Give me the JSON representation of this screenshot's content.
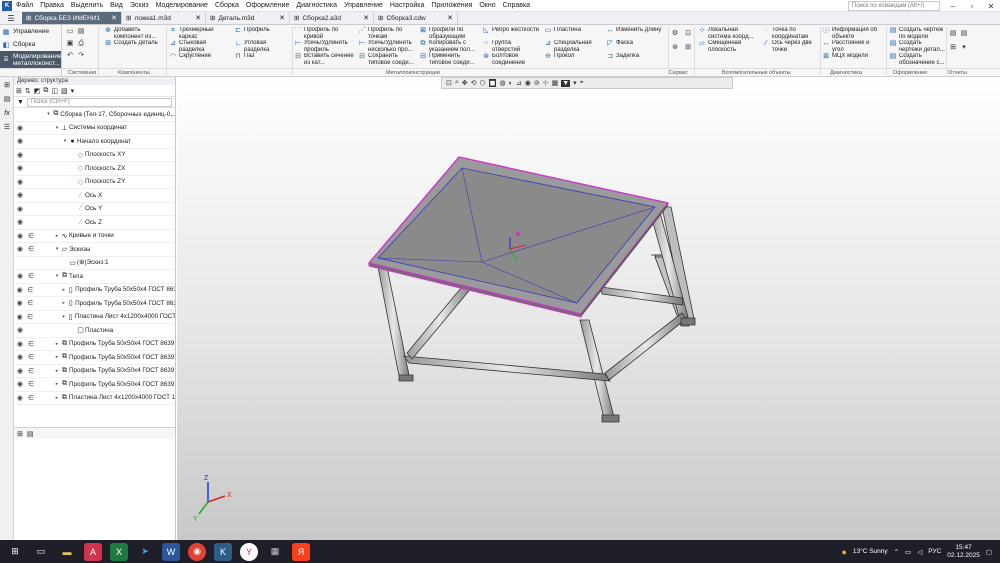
{
  "menu": [
    "Файл",
    "Правка",
    "Выделить",
    "Вид",
    "Эскиз",
    "Моделирование",
    "Сборка",
    "Оформление",
    "Диагностика",
    "Управление",
    "Настройка",
    "Приложения",
    "Окно",
    "Справка"
  ],
  "command_search_placeholder": "Поиск по командам (Alt+/)",
  "tabs": [
    {
      "label": "Сборка БЕЗ ИМЕНИ1",
      "active": true
    },
    {
      "label": "ложка1.m3d",
      "active": false
    },
    {
      "label": "Деталь.m3d",
      "active": false
    },
    {
      "label": "Сборка2.a3d",
      "active": false
    },
    {
      "label": "Сборка3.cdw",
      "active": false
    }
  ],
  "ribbon_left_tabs": [
    "Управление",
    "Сборка",
    "Моделирование металлоконст..."
  ],
  "ribbon": {
    "col1": [
      "Добавить компонент из...",
      "Создать деталь"
    ],
    "col2": [
      "Трехмерный каркас",
      "Стыковая разделка",
      "Скругление"
    ],
    "col3": [
      "Профиль",
      "Угловая разделка",
      "Паз"
    ],
    "col4": [
      "Профиль по кривой",
      "Усечь/Удлинить профиль",
      "Вставить сечение из кат..."
    ],
    "col5": [
      "Профиль по точкам",
      "Усечь/Удлинить несколько про...",
      "Сохранить типовое соеди..."
    ],
    "col6": [
      "Профили по образующим",
      "Копировать с указанием пол...",
      "Применить типовое соеди..."
    ],
    "col7": [
      "Ребро жесткости",
      "Группа отверстий",
      "Болтовое соединение"
    ],
    "col8": [
      "Пластина",
      "Специальная разделка",
      "Прокол"
    ],
    "col9": [
      "Изменить длину",
      "Фаска",
      "Заделка"
    ],
    "col10": [
      "Локальная система коорд...",
      "Смещенная плоскость"
    ],
    "col11": [
      "Точка по координатам",
      "Ось через две точки"
    ],
    "col12": [
      "Информация об объекте",
      "Расстояние и угол",
      "МЦХ модели"
    ],
    "col13": [
      "Создать чертеж по модели",
      "Создать чертежи детал...",
      "Создать обозначение с..."
    ]
  },
  "ribbon_groups": [
    "Системная",
    "Компоненты",
    "Металлоконструкции",
    "Сервис",
    "Вспомогательные объекты",
    "Диагностика",
    "Оформление",
    "Отчеты"
  ],
  "panel": {
    "title": "Дерево: структура",
    "search_placeholder": "Поиск (Ctrl+F)"
  },
  "tree": [
    {
      "label": "Сборка (Тел-17, Сборочных единиц-0,...",
      "level": 0,
      "icon": "assembly-icon",
      "eye": false,
      "sub": false,
      "twisty": "▾"
    },
    {
      "label": "Системы координат",
      "level": 1,
      "icon": "axes-icon",
      "eye": true,
      "sub": false,
      "twisty": "▾"
    },
    {
      "label": "Начало координат",
      "level": 2,
      "icon": "origin-icon",
      "eye": true,
      "sub": false,
      "twisty": "▾"
    },
    {
      "label": "Плоскость XY",
      "level": 3,
      "icon": "plane-xy-icon",
      "eye": true,
      "sub": false,
      "twisty": ""
    },
    {
      "label": "Плоскость ZX",
      "level": 3,
      "icon": "plane-zx-icon",
      "eye": true,
      "sub": false,
      "twisty": ""
    },
    {
      "label": "Плоскость ZY",
      "level": 3,
      "icon": "plane-zy-icon",
      "eye": true,
      "sub": false,
      "twisty": ""
    },
    {
      "label": "Ось X",
      "level": 3,
      "icon": "axis-x-icon",
      "eye": true,
      "sub": false,
      "twisty": ""
    },
    {
      "label": "Ось Y",
      "level": 3,
      "icon": "axis-y-icon",
      "eye": true,
      "sub": false,
      "twisty": ""
    },
    {
      "label": "Ось Z",
      "level": 3,
      "icon": "axis-z-icon",
      "eye": true,
      "sub": false,
      "twisty": ""
    },
    {
      "label": "Кривые и точки",
      "level": 1,
      "icon": "curve-icon",
      "eye": true,
      "sub": true,
      "twisty": "▸"
    },
    {
      "label": "Эскизы",
      "level": 1,
      "icon": "sketch-folder-icon",
      "eye": true,
      "sub": true,
      "twisty": "▾"
    },
    {
      "label": "(⊕)Эскиз:1",
      "level": 2,
      "icon": "sketch-icon",
      "eye": false,
      "sub": false,
      "twisty": ""
    },
    {
      "label": "Тела",
      "level": 1,
      "icon": "bodies-icon",
      "eye": true,
      "sub": true,
      "twisty": "▾"
    },
    {
      "label": "Профиль Труба  50x50x4 ГОСТ 8639",
      "level": 2,
      "icon": "profile-icon",
      "eye": true,
      "sub": true,
      "twisty": "▸"
    },
    {
      "label": "Профиль Труба  50x50x4 ГОСТ 8639",
      "level": 2,
      "icon": "profile-icon",
      "eye": true,
      "sub": true,
      "twisty": "▸"
    },
    {
      "label": "Пластина Лист  4x1200x4000 ГОСТ 1",
      "level": 2,
      "icon": "plate-icon",
      "eye": true,
      "sub": true,
      "twisty": "▾"
    },
    {
      "label": "Пластина",
      "level": 3,
      "icon": "plate-body-icon",
      "eye": true,
      "sub": false,
      "twisty": ""
    },
    {
      "label": "Профиль Труба  50x50x4 ГОСТ 8639",
      "level": 1,
      "icon": "profile-group-icon",
      "eye": true,
      "sub": true,
      "twisty": "▸"
    },
    {
      "label": "Профиль Труба  50x50x4 ГОСТ 8639",
      "level": 1,
      "icon": "profile-group-icon",
      "eye": true,
      "sub": true,
      "twisty": "▸"
    },
    {
      "label": "Профиль Труба  50x50x4 ГОСТ 8639",
      "level": 1,
      "icon": "profile-group-icon",
      "eye": true,
      "sub": true,
      "twisty": "▸"
    },
    {
      "label": "Профиль Труба  50x50x4 ГОСТ 8639",
      "level": 1,
      "icon": "profile-group-icon",
      "eye": true,
      "sub": true,
      "twisty": "▸"
    },
    {
      "label": "Пластина Лист  4x1200x4000 ГОСТ 1",
      "level": 1,
      "icon": "plate-group-icon",
      "eye": true,
      "sub": true,
      "twisty": "▸"
    }
  ],
  "axis_triad": {
    "x": "X",
    "y": "Y",
    "z": "Z"
  },
  "tray": {
    "weather": "13°C  Sunny",
    "lang": "РУС",
    "time": "15:47",
    "date": "02.12.2025"
  },
  "colors": {
    "accent": "#1a5fa8",
    "active_tab": "#5b6b7c",
    "taskbar": "#1f1f2a",
    "plate": "#8a8a8a",
    "edge_highlight": "#c838c8"
  }
}
